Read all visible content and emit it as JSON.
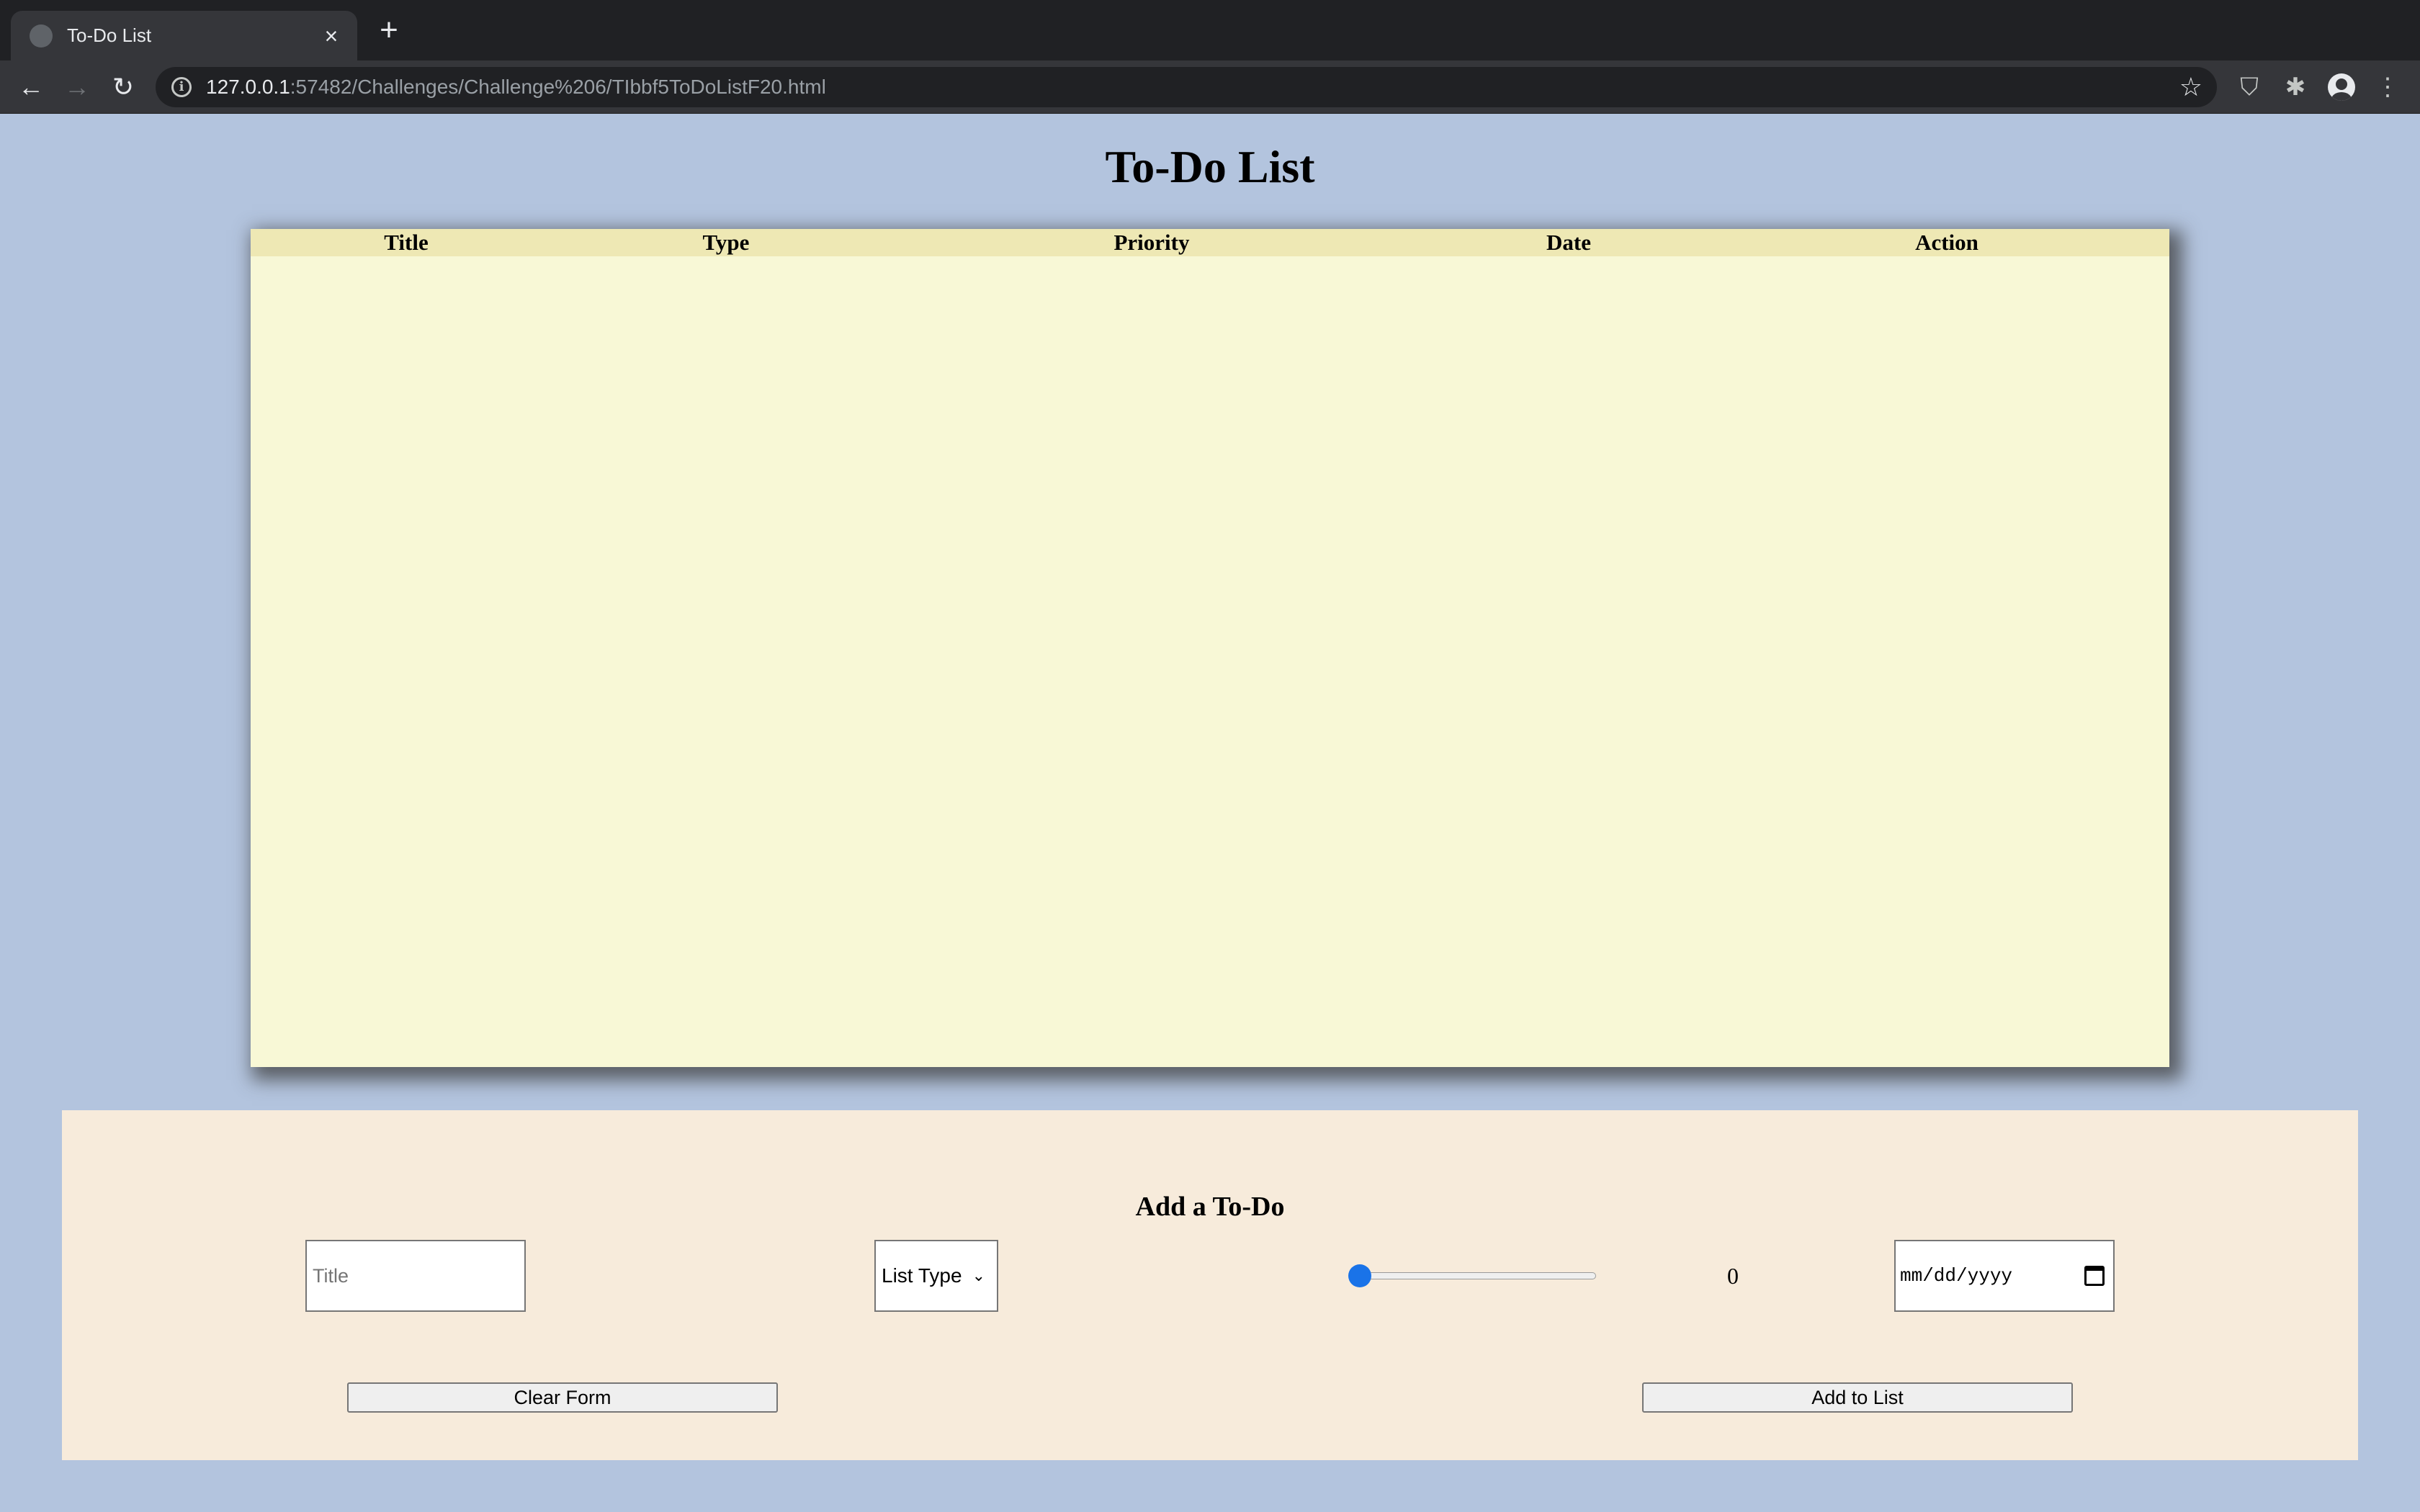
{
  "browser": {
    "tab_title": "To-Do List",
    "tab_close_icon": "×",
    "new_tab_icon": "+",
    "url_host": "127.0.0.1",
    "url_rest": ":57482/Challenges/Challenge%206/TIbbf5ToDoListF20.html"
  },
  "page": {
    "title": "To-Do List"
  },
  "table": {
    "columns": [
      "Title",
      "Type",
      "Priority",
      "Date",
      "Action"
    ]
  },
  "form": {
    "heading": "Add a To-Do",
    "title_placeholder": "Title",
    "type_select_value": "List Type",
    "priority_value": "0",
    "date_placeholder": "mm/dd/yyyy",
    "clear_label": "Clear Form",
    "add_label": "Add to List"
  },
  "colors": {
    "page_bg": "#b3c4de",
    "table_bg": "#f8f8d6",
    "table_header_bg": "#eee8b4",
    "form_bg": "#f7ebdb",
    "slider_accent": "#1a73e8"
  }
}
